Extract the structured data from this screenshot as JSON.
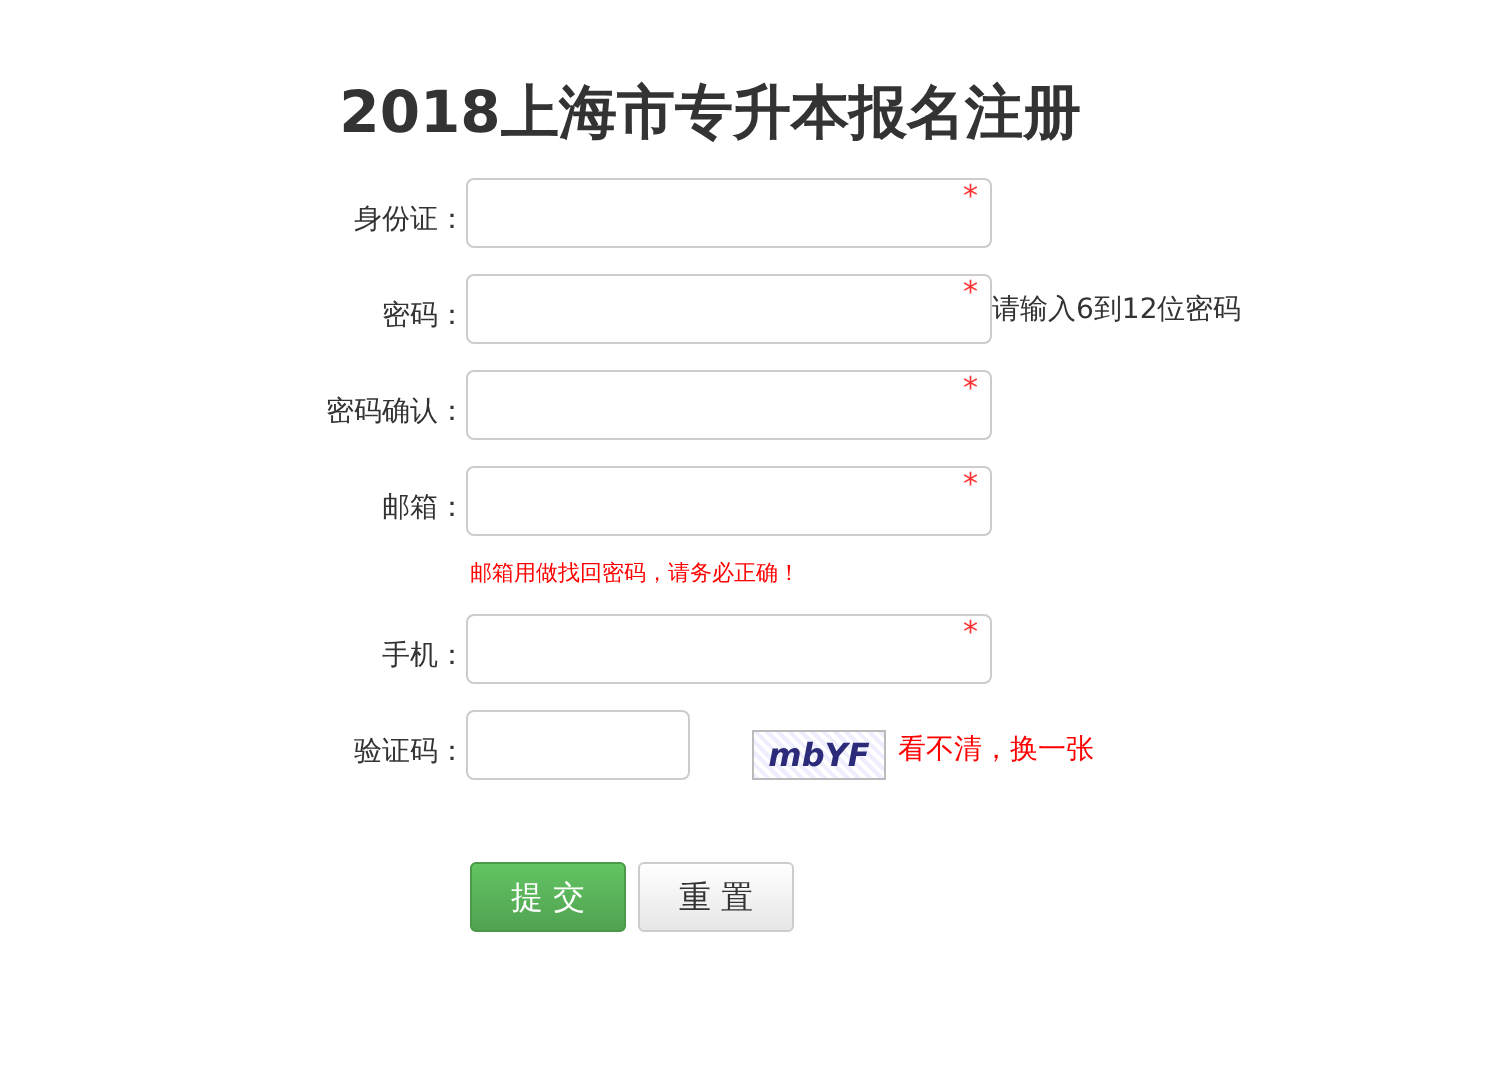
{
  "title": "2018上海市专升本报名注册",
  "fields": [
    {
      "label": "身份证：",
      "required_mark": "*"
    },
    {
      "label": "密码：",
      "required_mark": "*",
      "hint": "请输入6到12位密码"
    },
    {
      "label": "密码确认：",
      "required_mark": "*"
    },
    {
      "label": "邮箱：",
      "required_mark": "*",
      "note": "邮箱用做找回密码，请务必正确！"
    },
    {
      "label": "手机：",
      "required_mark": "*"
    }
  ],
  "captcha": {
    "label": "验证码：",
    "image_text": "mbYF",
    "refresh_link": "看不清，换一张"
  },
  "buttons": [
    {
      "label": "提 交",
      "kind": "primary"
    },
    {
      "label": "重 置",
      "kind": "secondary"
    }
  ]
}
